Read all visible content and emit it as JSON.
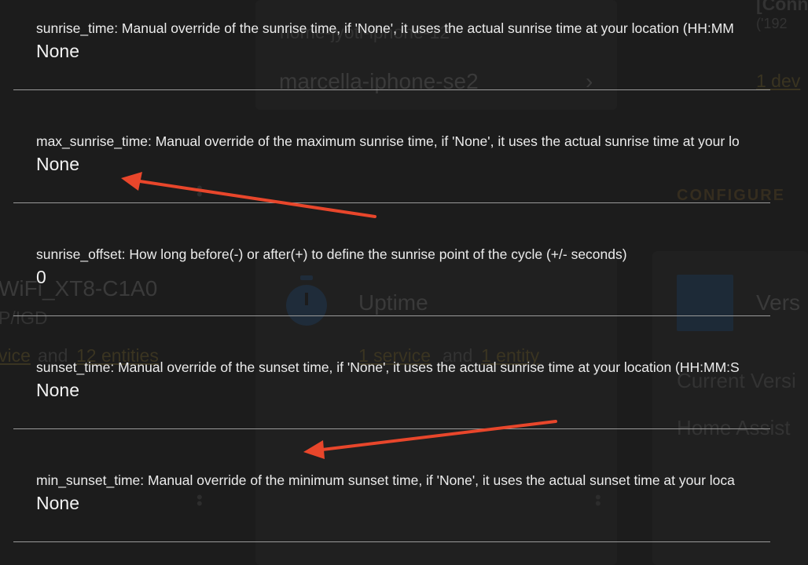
{
  "colors": {
    "background": "#1c1c1c",
    "text": "#ececec",
    "divider": "#9a9a9a",
    "annotation_arrow": "#e8462b"
  },
  "fields": [
    {
      "description": "sunrise_time: Manual override of the sunrise time, if 'None', it uses the actual sunrise time at your location (HH:MM",
      "value": "None"
    },
    {
      "description": "max_sunrise_time: Manual override of the maximum sunrise time, if 'None', it uses the actual sunrise time at your lo",
      "value": "None"
    },
    {
      "description": "sunrise_offset: How long before(-) or after(+) to define the sunrise point of the cycle (+/- seconds)",
      "value": "0"
    },
    {
      "description": "sunset_time: Manual override of the sunset time, if 'None', it uses the actual sunrise time at your location (HH:MM:S",
      "value": "None"
    },
    {
      "description": "min_sunset_time: Manual override of the minimum sunset time, if 'None', it uses the actual sunset time at your loca",
      "value": "None"
    }
  ],
  "annotations": {
    "arrow_icon": "arrow-left-icon",
    "count": 2
  },
  "background_page": {
    "top_right_partial": "[Conn",
    "top_right_partial_2": "('192",
    "device_header": "home-jyoti-iphone-12",
    "device_name": "marcella-iphone-se2",
    "device_link": "1 dev",
    "configure_label": "CONFIGURE",
    "left_title": "WiFi_XT8-C1A0",
    "left_subtitle": "P/IGD",
    "left_links_a": "vice",
    "left_and_1": "and",
    "left_links_b": "12 entities",
    "uptime_title": "Uptime",
    "uptime_link_a": "1 service",
    "uptime_and": "and",
    "uptime_link_b": "1 entity",
    "version_title": "Vers",
    "version_sub": "Current Versi",
    "version_sub2": "Home Assist"
  }
}
